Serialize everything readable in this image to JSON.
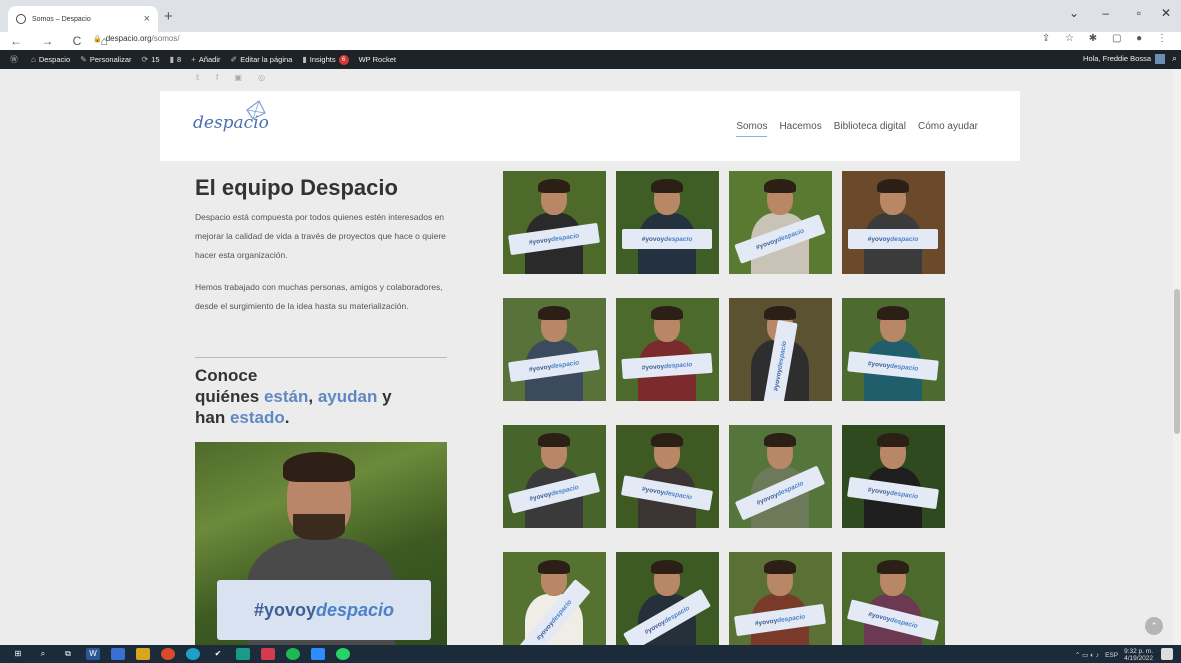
{
  "browser": {
    "tab_title": "Somos – Despacio",
    "tab_close": "×",
    "new_tab": "+",
    "url_domain": "despacio.org",
    "url_path": "/somos/",
    "window_controls": [
      "⌄",
      "–",
      "▫",
      "✕"
    ]
  },
  "adminbar": {
    "items": [
      {
        "label": "Despacio"
      },
      {
        "label": "Personalizar"
      },
      {
        "label": "15"
      },
      {
        "label": "8"
      },
      {
        "label": "Añadir"
      },
      {
        "label": "Editar la página"
      },
      {
        "label": "Insights"
      },
      {
        "label": "WP Rocket"
      }
    ],
    "insights_badge": "6",
    "greeting": "Hola, Freddie Bossa"
  },
  "site": {
    "logo": "despacio",
    "menu": [
      "Somos",
      "Hacemos",
      "Biblioteca digital",
      "Cómo ayudar"
    ],
    "active_menu": "Somos"
  },
  "main": {
    "title": "El equipo Despacio",
    "paragraph1": "Despacio está compuesta por todos quienes estén interesados en mejorar la calidad de vida a través de proyectos que hace o quiere hacer esta organización.",
    "paragraph2": "Hemos trabajado con muchas personas, amigos y colaboradores, desde el surgimiento de la idea hasta su materialización.",
    "conoce": {
      "line1": "Conoce",
      "quienes": "quiénes ",
      "estan": "están",
      "comma": ", ",
      "ayudan": "ayudan",
      "y": " y",
      "han": "han ",
      "estado": "estado",
      "period": "."
    },
    "feature_sign_prefix": "#yovoy",
    "feature_sign_suffix": "despacio"
  },
  "photos": {
    "sign_prefix": "#yovoy",
    "sign_suffix": "despacio",
    "count": 16
  },
  "colors": {
    "accent": "#5f88c4",
    "admin_bg": "#1d2327",
    "taskbar_bg": "#1c2b3a"
  },
  "taskbar": {
    "lang": "ESP",
    "time": "9:32 p. m.",
    "date": "4/19/2022"
  }
}
